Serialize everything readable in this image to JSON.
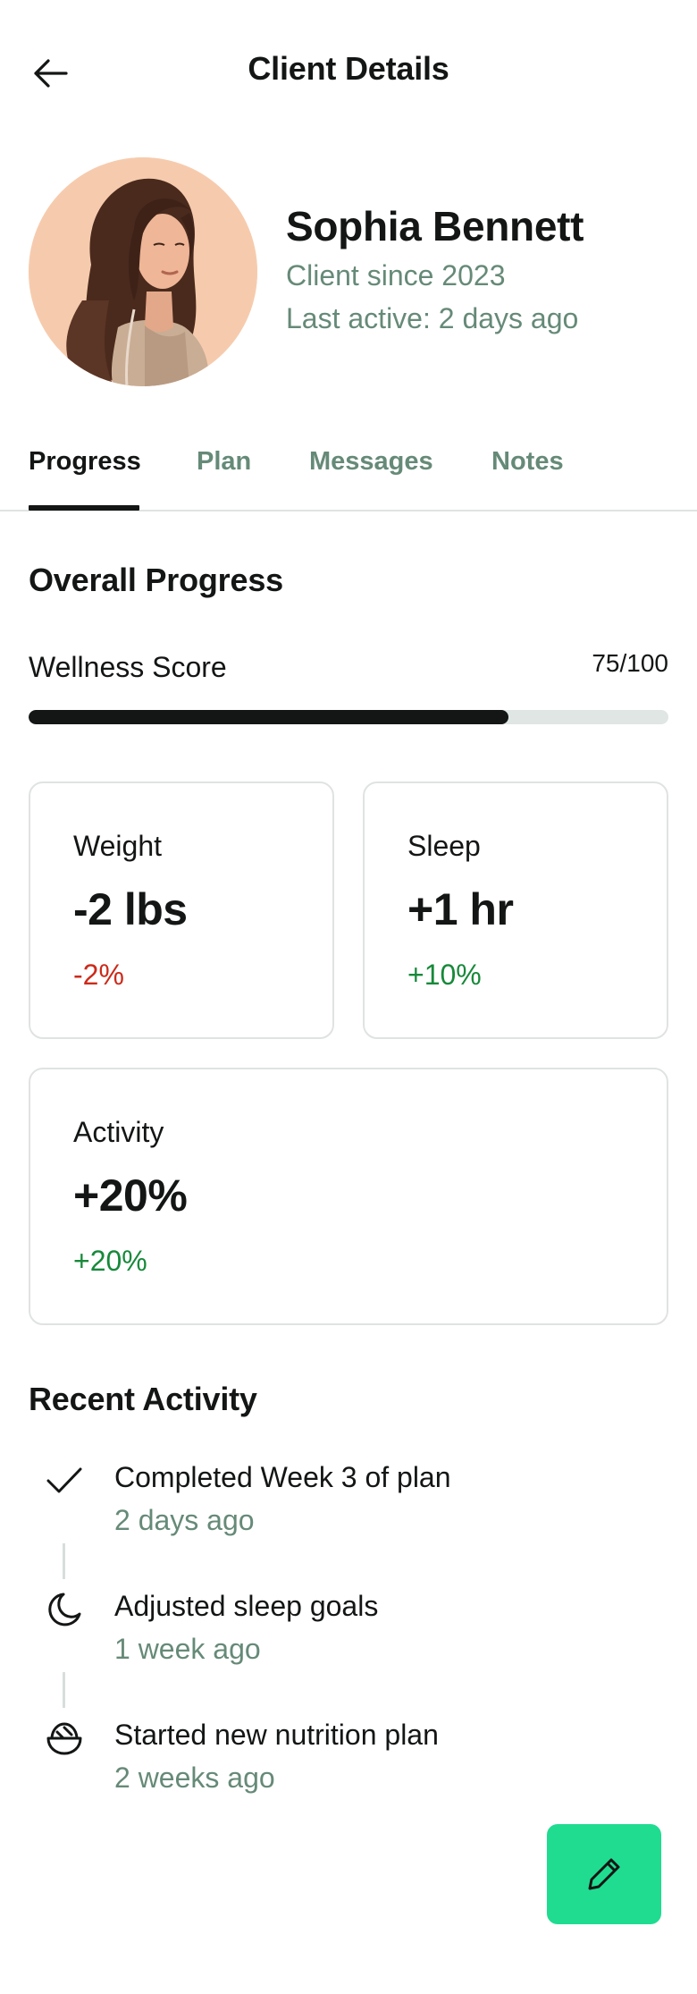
{
  "header": {
    "title": "Client Details",
    "back_icon": "arrow-left-icon"
  },
  "profile": {
    "name": "Sophia Bennett",
    "since": "Client since 2023",
    "last_active": "Last active: 2 days ago"
  },
  "tabs": [
    {
      "label": "Progress",
      "active": true
    },
    {
      "label": "Plan",
      "active": false
    },
    {
      "label": "Messages",
      "active": false
    },
    {
      "label": "Notes",
      "active": false
    }
  ],
  "overall": {
    "title": "Overall Progress",
    "wellness_label": "Wellness Score",
    "wellness_value": "75/100",
    "wellness_fraction": 0.75
  },
  "stats": [
    {
      "label": "Weight",
      "value": "-2 lbs",
      "change": "-2%",
      "trend": "negative"
    },
    {
      "label": "Sleep",
      "value": "+1 hr",
      "change": "+10%",
      "trend": "positive"
    },
    {
      "label": "Activity",
      "value": "+20%",
      "change": "+20%",
      "trend": "positive"
    }
  ],
  "recent": {
    "title": "Recent Activity",
    "items": [
      {
        "icon": "checkmark-icon",
        "title": "Completed Week 3 of plan",
        "time": "2 days ago"
      },
      {
        "icon": "moon-icon",
        "title": "Adjusted sleep goals",
        "time": "1 week ago"
      },
      {
        "icon": "bowl-icon",
        "title": "Started new nutrition plan",
        "time": "2 weeks ago"
      }
    ]
  },
  "fab": {
    "icon": "pencil-icon"
  },
  "colors": {
    "accent": "#1fdc91",
    "muted_text": "#668a78",
    "negative": "#cc2a1a",
    "positive": "#17893a",
    "progress_fill": "#131614",
    "progress_track": "#e0e6e3",
    "avatar_bg": "#f6cbad"
  }
}
